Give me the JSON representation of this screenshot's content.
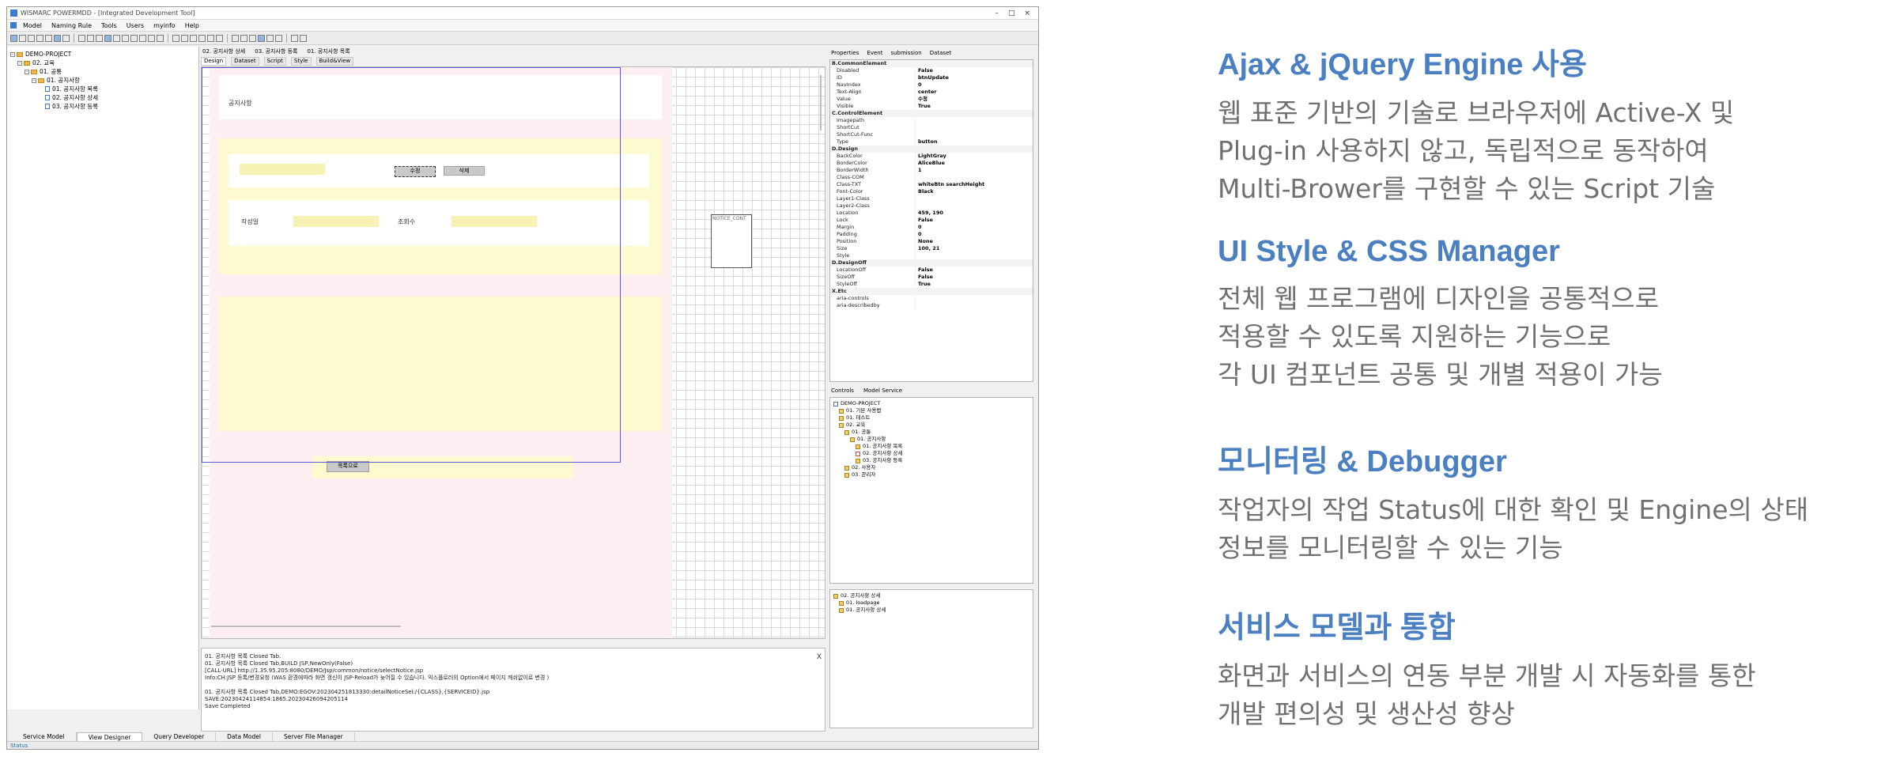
{
  "window": {
    "title": "WISMARC POWERMDD - [Integrated Development Tool]",
    "controls": [
      "–",
      "□",
      "×"
    ]
  },
  "menu": [
    "Model",
    "Naming Rule",
    "Tools",
    "Users",
    "myinfo",
    "Help"
  ],
  "project_tree": [
    {
      "label": "DEMO-PROJECT",
      "level": 0,
      "icon": "folder-icon"
    },
    {
      "label": "02. 교육",
      "level": 1,
      "icon": "folder-icon"
    },
    {
      "label": "01. 공통",
      "level": 2,
      "icon": "folder-icon"
    },
    {
      "label": "01. 공지사항",
      "level": 3,
      "icon": "folder-icon"
    },
    {
      "label": "01. 공지사항 목록",
      "level": 4,
      "icon": "document-icon"
    },
    {
      "label": "02. 공지사항 상세",
      "level": 4,
      "icon": "document-icon"
    },
    {
      "label": "03. 공지사항 등록",
      "level": 4,
      "icon": "document-icon"
    }
  ],
  "doc_tabs": [
    "02. 공지사항 상세",
    "03. 공지사항 등록",
    "01. 공지사항 목록"
  ],
  "sub_tabs": [
    "Design",
    "Dataset",
    "Script",
    "Style",
    "Build&View"
  ],
  "design": {
    "page_title": "공지사항",
    "edit_button": "수정",
    "delete_button": "삭제",
    "writer_label": "작성일",
    "views_label": "조회수",
    "list_button": "목록으로",
    "floating_control_label": "NOTICE_CONT"
  },
  "output_lines": [
    "01. 공지사항 목록 Closed Tab.",
    "01. 공지사항 목록 Closed Tab,BUILD JSP,NewOnly(False)",
    "[CALL-URL] http://1.35.95.205:8080/DEMO/Jsp/common/notice/selectNotice.jsp",
    "Info:CH:JSP 등록/변경요청 (WAS 환경에따라 화면 갱신이 JSP-Reload가 늦어질 수 있습니다. 익스플로러의 Option에서 페이지 캐쉬없이로 변경 )",
    "",
    "01. 공지사항 목록 Closed Tab,DEMO:EGOV:202304251813330:detailNoticeSel:/{CLASS},{SERVICEID}.jsp",
    "SAVE:20230424114854:1865.20230426094205114",
    "Save Completed"
  ],
  "bottom_tabs": [
    "Service Model",
    "View Designer",
    "Query Developer",
    "Data Model",
    "Server File Manager"
  ],
  "status_text": "Status",
  "prop_tabs": [
    "Properties",
    "Event",
    "submission",
    "Dataset"
  ],
  "properties": [
    {
      "section": "B.CommonElement"
    },
    {
      "k": "Disabled",
      "v": "False"
    },
    {
      "k": "ID",
      "v": "btnUpdate"
    },
    {
      "k": "NavIndex",
      "v": "0"
    },
    {
      "k": "Text-Align",
      "v": "center"
    },
    {
      "k": "Value",
      "v": "수정"
    },
    {
      "k": "Visible",
      "v": "True"
    },
    {
      "section": "C.ControlElement"
    },
    {
      "k": "Imagepath",
      "v": ""
    },
    {
      "k": "ShortCut",
      "v": ""
    },
    {
      "k": "ShortCut-Func",
      "v": ""
    },
    {
      "k": "Type",
      "v": "button"
    },
    {
      "section": "D.Design"
    },
    {
      "k": "BackColor",
      "v": "LightGray"
    },
    {
      "k": "BorderColor",
      "v": "AliceBlue"
    },
    {
      "k": "BorderWidth",
      "v": "1"
    },
    {
      "k": "Class-COM",
      "v": ""
    },
    {
      "k": "Class-TXT",
      "v": "whiteBtn searchHeight"
    },
    {
      "k": "Font-Color",
      "v": "Black"
    },
    {
      "k": "Layer1-Class",
      "v": ""
    },
    {
      "k": "Layer2-Class",
      "v": ""
    },
    {
      "k": "Location",
      "v": "459, 190"
    },
    {
      "k": "Lock",
      "v": "False"
    },
    {
      "k": "Margin",
      "v": "0"
    },
    {
      "k": "Padding",
      "v": "0"
    },
    {
      "k": "Position",
      "v": "None"
    },
    {
      "k": "Size",
      "v": "100, 21"
    },
    {
      "k": "Style",
      "v": ""
    },
    {
      "section": "D.DesignOff"
    },
    {
      "k": "LocationOff",
      "v": "False"
    },
    {
      "k": "SizeOff",
      "v": "False"
    },
    {
      "k": "StyleOff",
      "v": "True"
    },
    {
      "section": "X.Etc"
    },
    {
      "k": "aria-controls",
      "v": ""
    },
    {
      "k": "aria-describedby",
      "v": ""
    }
  ],
  "mid_tabs": [
    "Controls",
    "Model Service"
  ],
  "model_tree": [
    {
      "label": "DEMO-PROJECT",
      "level": 0,
      "icon": "doc"
    },
    {
      "label": "01. 기본 사용법",
      "level": 1,
      "icon": "folder"
    },
    {
      "label": "01. 테스트",
      "level": 1,
      "icon": "folder"
    },
    {
      "label": "02. 교육",
      "level": 1,
      "icon": "folder"
    },
    {
      "label": "01. 공통",
      "level": 2,
      "icon": "folder"
    },
    {
      "label": "01. 공지사항",
      "level": 3,
      "icon": "folder"
    },
    {
      "label": "01. 공지사항 목록",
      "level": 4,
      "icon": "folder"
    },
    {
      "label": "02. 공지사항 상세",
      "level": 4,
      "icon": "red"
    },
    {
      "label": "03. 공지사항 등록",
      "level": 4,
      "icon": "folder"
    },
    {
      "label": "02. 사용자",
      "level": 2,
      "icon": "folder"
    },
    {
      "label": "03. 관리자",
      "level": 2,
      "icon": "folder"
    }
  ],
  "low_tree": [
    {
      "label": "02. 공지사항 상세",
      "level": 0
    },
    {
      "label": "01. loadpage",
      "level": 1
    },
    {
      "label": "01. 공지사항 상세",
      "level": 1
    }
  ],
  "features": [
    {
      "title": "Ajax & jQuery Engine 사용",
      "lines": [
        "웹 표준 기반의 기술로 브라우저에 Active-X 및",
        "Plug-in 사용하지 않고, 독립적으로 동작하여",
        "Multi-Brower를 구현할 수 있는 Script 기술"
      ]
    },
    {
      "title": "UI Style & CSS Manager",
      "lines": [
        "전체 웹 프로그램에 디자인을 공통적으로",
        "적용할 수 있도록 지원하는 기능으로",
        "각 UI 컴포넌트 공통 및  개별 적용이 가능"
      ]
    },
    {
      "title": "모니터링 & Debugger",
      "lines": [
        "작업자의 작업 Status에 대한 확인 및 Engine의 상태",
        "정보를 모니터링할 수 있는 기능"
      ]
    },
    {
      "title": "서비스 모델과 통합",
      "lines": [
        "화면과 서비스의 연동 부분 개발 시 자동화를 통한",
        "개발 편의성 및 생산성 향상"
      ]
    }
  ],
  "colors": {
    "heading": "#4a7fc1",
    "body_text": "#707070",
    "form_yellow": "#fdfad0",
    "page_pink": "#fdeef1"
  }
}
